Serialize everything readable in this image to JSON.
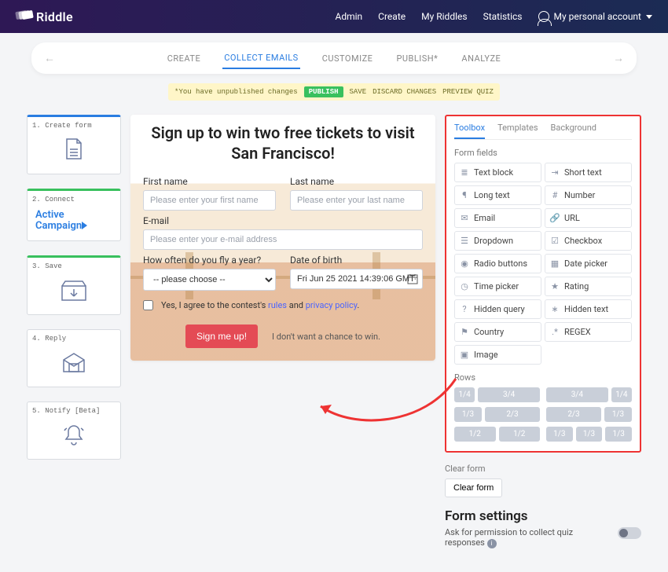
{
  "nav": {
    "brand": "Riddle",
    "links": [
      "Admin",
      "Create",
      "My Riddles",
      "Statistics"
    ],
    "account": "My personal account"
  },
  "tabs": {
    "items": [
      "CREATE",
      "COLLECT EMAILS",
      "CUSTOMIZE",
      "PUBLISH*",
      "ANALYZE"
    ],
    "active_index": 1
  },
  "status": {
    "msg": "*You have unpublished changes",
    "publish": "PUBLISH",
    "save": "SAVE",
    "discard": "DISCARD CHANGES",
    "preview": "PREVIEW QUIZ"
  },
  "steps": [
    {
      "title": "1. Create form"
    },
    {
      "title": "2. Connect"
    },
    {
      "title": "3. Save"
    },
    {
      "title": "4. Reply"
    },
    {
      "title": "5. Notify [Beta]"
    }
  ],
  "ac_logo_line1": "Active",
  "ac_logo_line2": "Campaign",
  "preview": {
    "title": "Sign up to win two free tickets  to visit San Francisco!",
    "first_name_label": "First name",
    "first_name_ph": "Please enter your first name",
    "last_name_label": "Last name",
    "last_name_ph": "Please enter your last name",
    "email_label": "E-mail",
    "email_ph": "Please enter your e-mail address",
    "freq_label": "How often do you fly a year?",
    "freq_value": "-- please choose --",
    "dob_label": "Date of birth",
    "dob_value": "Fri Jun 25 2021 14:39:06 GMT-",
    "consent_pre": "Yes, I agree to the contest's ",
    "consent_rules": "rules",
    "consent_and": " and ",
    "consent_priv": "privacy policy",
    "consent_dot": ".",
    "submit": "Sign me up!",
    "decline": "I don't want a chance to win."
  },
  "toolbox": {
    "tabs": [
      "Toolbox",
      "Templates",
      "Background"
    ],
    "active_index": 0,
    "fields_header": "Form fields",
    "fields": [
      {
        "icon": "≣",
        "label": "Text block"
      },
      {
        "icon": "⇥",
        "label": "Short text"
      },
      {
        "icon": "¶",
        "label": "Long text"
      },
      {
        "icon": "#",
        "label": "Number"
      },
      {
        "icon": "✉",
        "label": "Email"
      },
      {
        "icon": "🔗",
        "label": "URL"
      },
      {
        "icon": "☰",
        "label": "Dropdown"
      },
      {
        "icon": "☑",
        "label": "Checkbox"
      },
      {
        "icon": "◉",
        "label": "Radio buttons"
      },
      {
        "icon": "▦",
        "label": "Date picker"
      },
      {
        "icon": "◷",
        "label": "Time picker"
      },
      {
        "icon": "★",
        "label": "Rating"
      },
      {
        "icon": "?",
        "label": "Hidden query"
      },
      {
        "icon": "∗",
        "label": "Hidden text"
      },
      {
        "icon": "⚑",
        "label": "Country"
      },
      {
        "icon": ".*",
        "label": "REGEX"
      },
      {
        "icon": "▣",
        "label": "Image"
      }
    ],
    "rows_header": "Rows",
    "row_lines": [
      [
        [
          "1/4",
          "3/4"
        ],
        [
          "3/4",
          "1/4"
        ]
      ],
      [
        [
          "1/3",
          "2/3"
        ],
        [
          "2/3",
          "1/3"
        ]
      ],
      [
        [
          "1/2",
          "1/2"
        ],
        [
          "1/3",
          "1/3",
          "1/3"
        ]
      ]
    ],
    "clear_header": "Clear form",
    "clear_btn": "Clear form",
    "settings_header": "Form settings",
    "perm_label": "Ask for permission to collect quiz responses"
  }
}
